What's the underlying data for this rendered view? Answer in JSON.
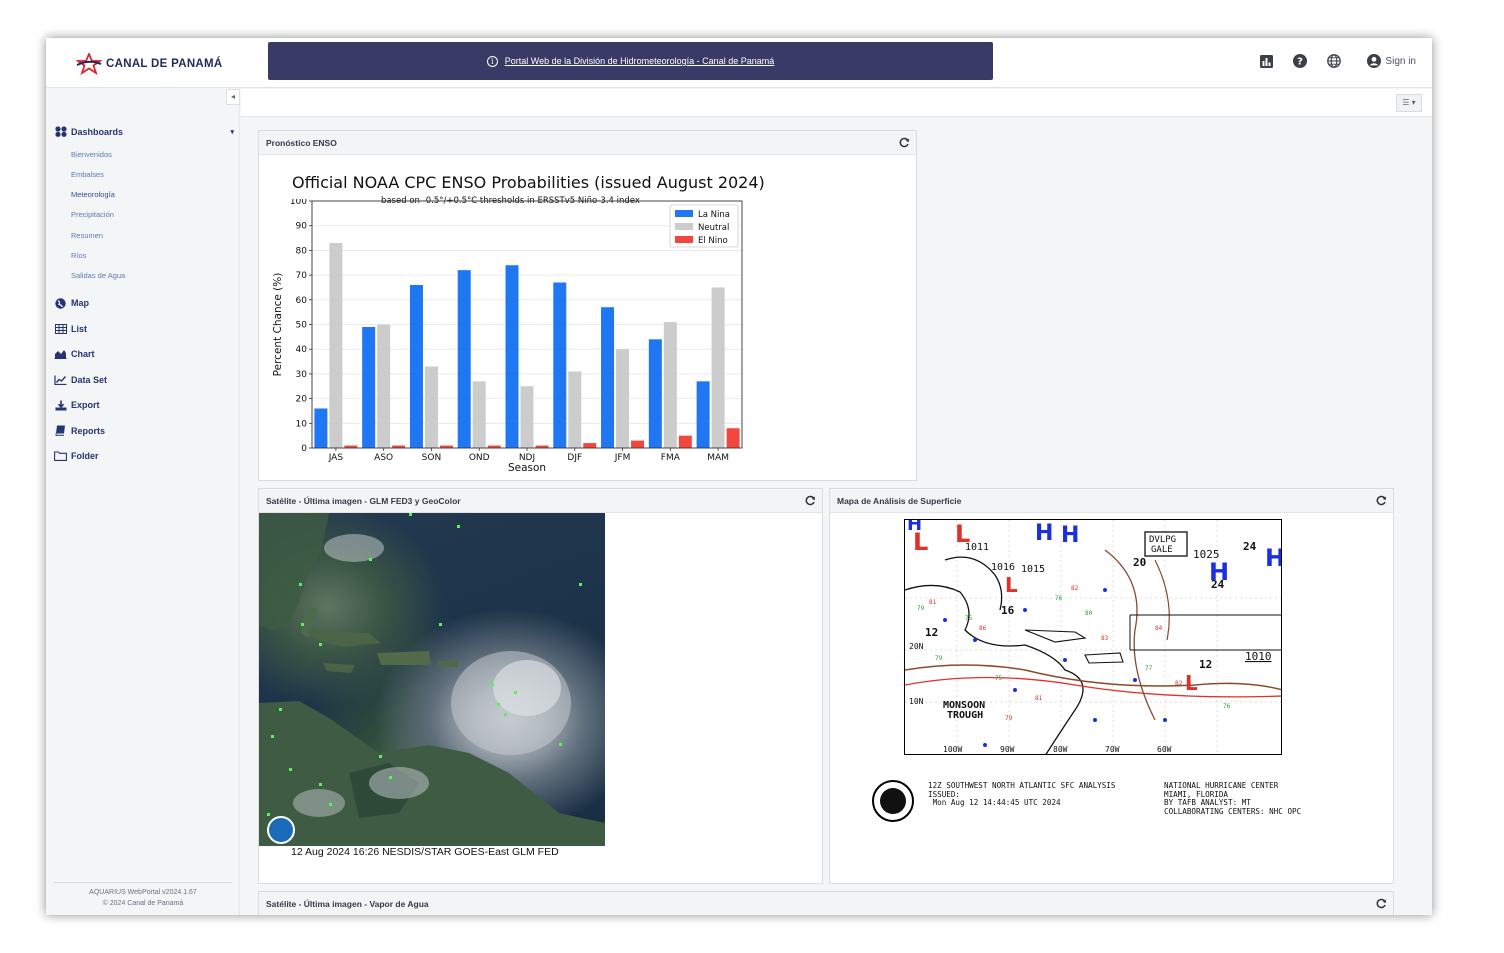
{
  "header": {
    "logo_text": "CANAL DE PANAMÁ",
    "banner_link": "Portal Web de la División de Hidrometeorología - Canal de Panamá",
    "sign_in": "Sign in"
  },
  "sidebar": {
    "dashboards_label": "Dashboards",
    "dashboard_items": [
      {
        "label": "Bienvenidos"
      },
      {
        "label": "Embalses"
      },
      {
        "label": "Meteorología"
      },
      {
        "label": "Precipitación"
      },
      {
        "label": "Resumen"
      },
      {
        "label": "Ríos"
      },
      {
        "label": "Salidas de Agua"
      }
    ],
    "main_items": [
      {
        "label": "Map",
        "icon": "globe-icon"
      },
      {
        "label": "List",
        "icon": "table-icon"
      },
      {
        "label": "Chart",
        "icon": "area-chart-icon"
      },
      {
        "label": "Data Set",
        "icon": "line-chart-icon"
      },
      {
        "label": "Export",
        "icon": "download-icon"
      },
      {
        "label": "Reports",
        "icon": "book-icon"
      },
      {
        "label": "Folder",
        "icon": "folder-icon"
      }
    ],
    "footer_version": "AQUARIUS WebPortal v2024.1.67",
    "footer_copyright": "© 2024 Canal de Panamá"
  },
  "panels": {
    "enso_title": "Pronóstico ENSO",
    "satellite_title": "Satélite - Última imagen - GLM FED3 y GeoColor",
    "surface_title": "Mapa de Análisis de Superficie",
    "vapor_title": "Satélite - Última imagen - Vapor de Agua",
    "satellite_caption": "12 Aug 2024 16:26 NESDIS/STAR GOES-East GLM FED"
  },
  "surface_map": {
    "caption_left": "12Z SOUTHWEST NORTH ATLANTIC SFC ANALYSIS\nISSUED:\n Mon Aug 12 14:44:45 UTC 2024",
    "caption_right": "NATIONAL HURRICANE CENTER\nMIAMI, FLORIDA\nBY TAFB ANALYST: MT\nCOLLABORATING CENTERS: NHC OPC",
    "labels": [
      "DVLPG",
      "GALE",
      "1025",
      "24",
      "24",
      "20",
      "16",
      "12",
      "1010",
      "12",
      "MONSOON",
      "TROUGH",
      "10N",
      "20N",
      "100W",
      "90W",
      "80W",
      "70W",
      "60W",
      "1016",
      "1015",
      "1011"
    ]
  },
  "chart_data": {
    "type": "bar",
    "title": "Official NOAA CPC ENSO Probabilities (issued August 2024)",
    "subtitle": "based on -0.5°/+0.5°C thresholds in ERSSTv5 Niño-3.4 index",
    "xlabel": "Season",
    "ylabel": "Percent Chance (%)",
    "ylim": [
      0,
      100
    ],
    "yticks": [
      0,
      10,
      20,
      30,
      40,
      50,
      60,
      70,
      80,
      90,
      100
    ],
    "categories": [
      "JAS",
      "ASO",
      "SON",
      "OND",
      "NDJ",
      "DJF",
      "JFM",
      "FMA",
      "MAM"
    ],
    "series": [
      {
        "name": "La Nina",
        "color": "#1f77f4",
        "values": [
          16,
          49,
          66,
          72,
          74,
          67,
          57,
          44,
          27
        ]
      },
      {
        "name": "Neutral",
        "color": "#cccccc",
        "values": [
          83,
          50,
          33,
          27,
          25,
          31,
          40,
          51,
          65
        ]
      },
      {
        "name": "El Nino",
        "color": "#f2473f",
        "values": [
          1,
          1,
          1,
          1,
          1,
          2,
          3,
          5,
          8
        ]
      }
    ],
    "legend_position": "top-right",
    "grid": true
  }
}
